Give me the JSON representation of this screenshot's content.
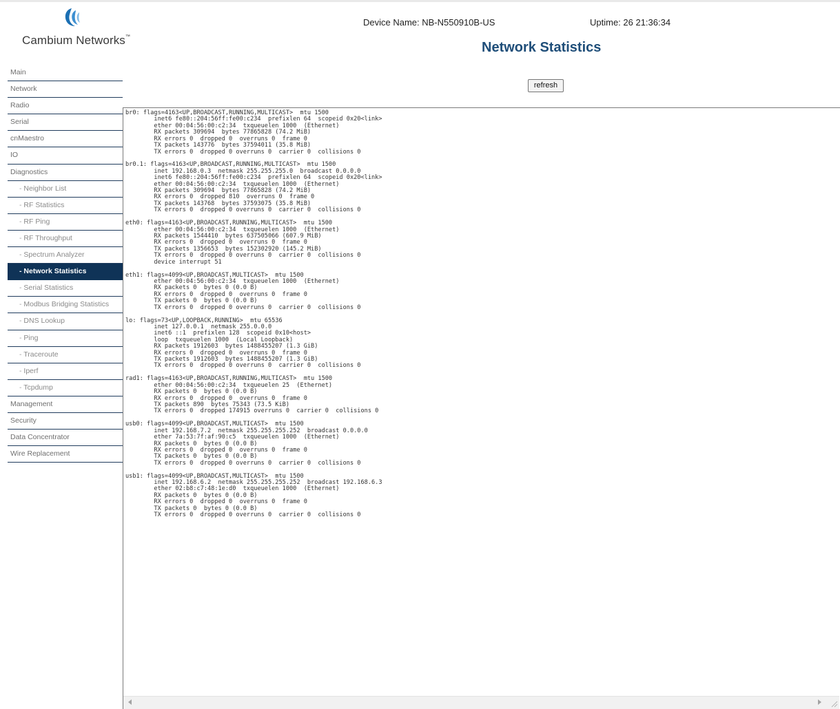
{
  "header": {
    "brand": "Cambium Networks",
    "trademark": "™",
    "device_name": "Device Name: NB-N550910B-US",
    "uptime": "Uptime: 26 21:36:34",
    "page_title": "Network Statistics"
  },
  "refresh_label": "refresh",
  "nav": {
    "items": [
      {
        "label": "Main",
        "sub": false,
        "active": false
      },
      {
        "label": "Network",
        "sub": false,
        "active": false
      },
      {
        "label": "Radio",
        "sub": false,
        "active": false
      },
      {
        "label": "Serial",
        "sub": false,
        "active": false
      },
      {
        "label": "cnMaestro",
        "sub": false,
        "active": false
      },
      {
        "label": "IO",
        "sub": false,
        "active": false
      },
      {
        "label": "Diagnostics",
        "sub": false,
        "active": false
      },
      {
        "label": "Neighbor List",
        "sub": true,
        "active": false
      },
      {
        "label": "RF Statistics",
        "sub": true,
        "active": false
      },
      {
        "label": "RF Ping",
        "sub": true,
        "active": false
      },
      {
        "label": "RF Throughput",
        "sub": true,
        "active": false
      },
      {
        "label": "Spectrum Analyzer",
        "sub": true,
        "active": false
      },
      {
        "label": "Network Statistics",
        "sub": true,
        "active": true
      },
      {
        "label": "Serial Statistics",
        "sub": true,
        "active": false
      },
      {
        "label": "Modbus Bridging Statistics",
        "sub": true,
        "active": false
      },
      {
        "label": "DNS Lookup",
        "sub": true,
        "active": false
      },
      {
        "label": "Ping",
        "sub": true,
        "active": false
      },
      {
        "label": "Traceroute",
        "sub": true,
        "active": false
      },
      {
        "label": "Iperf",
        "sub": true,
        "active": false
      },
      {
        "label": "Tcpdump",
        "sub": true,
        "active": false
      },
      {
        "label": "Management",
        "sub": false,
        "active": false
      },
      {
        "label": "Security",
        "sub": false,
        "active": false
      },
      {
        "label": "Data Concentrator",
        "sub": false,
        "active": false
      },
      {
        "label": "Wire Replacement",
        "sub": false,
        "active": false
      }
    ]
  },
  "stats_output": "br0: flags=4163<UP,BROADCAST,RUNNING,MULTICAST>  mtu 1500\n        inet6 fe80::204:56ff:fe00:c234  prefixlen 64  scopeid 0x20<link>\n        ether 00:04:56:00:c2:34  txqueuelen 1000  (Ethernet)\n        RX packets 309694  bytes 77865828 (74.2 MiB)\n        RX errors 0  dropped 0  overruns 0  frame 0\n        TX packets 143776  bytes 37594011 (35.8 MiB)\n        TX errors 0  dropped 0 overruns 0  carrier 0  collisions 0\n\nbr0.1: flags=4163<UP,BROADCAST,RUNNING,MULTICAST>  mtu 1500\n        inet 192.168.0.3  netmask 255.255.255.0  broadcast 0.0.0.0\n        inet6 fe80::204:56ff:fe00:c234  prefixlen 64  scopeid 0x20<link>\n        ether 00:04:56:00:c2:34  txqueuelen 1000  (Ethernet)\n        RX packets 309694  bytes 77865828 (74.2 MiB)\n        RX errors 0  dropped 810  overruns 0  frame 0\n        TX packets 143768  bytes 37593075 (35.8 MiB)\n        TX errors 0  dropped 0 overruns 0  carrier 0  collisions 0\n\neth0: flags=4163<UP,BROADCAST,RUNNING,MULTICAST>  mtu 1500\n        ether 00:04:56:00:c2:34  txqueuelen 1000  (Ethernet)\n        RX packets 1544410  bytes 637505066 (607.9 MiB)\n        RX errors 0  dropped 0  overruns 0  frame 0\n        TX packets 1356653  bytes 152302920 (145.2 MiB)\n        TX errors 0  dropped 0 overruns 0  carrier 0  collisions 0\n        device interrupt 51\n\neth1: flags=4099<UP,BROADCAST,MULTICAST>  mtu 1500\n        ether 00:04:56:00:c2:34  txqueuelen 1000  (Ethernet)\n        RX packets 0  bytes 0 (0.0 B)\n        RX errors 0  dropped 0  overruns 0  frame 0\n        TX packets 0  bytes 0 (0.0 B)\n        TX errors 0  dropped 0 overruns 0  carrier 0  collisions 0\n\nlo: flags=73<UP,LOOPBACK,RUNNING>  mtu 65536\n        inet 127.0.0.1  netmask 255.0.0.0\n        inet6 ::1  prefixlen 128  scopeid 0x10<host>\n        loop  txqueuelen 1000  (Local Loopback)\n        RX packets 1912603  bytes 1488455207 (1.3 GiB)\n        RX errors 0  dropped 0  overruns 0  frame 0\n        TX packets 1912603  bytes 1488455207 (1.3 GiB)\n        TX errors 0  dropped 0 overruns 0  carrier 0  collisions 0\n\nrad1: flags=4163<UP,BROADCAST,RUNNING,MULTICAST>  mtu 1500\n        ether 00:04:56:00:c2:34  txqueuelen 25  (Ethernet)\n        RX packets 0  bytes 0 (0.0 B)\n        RX errors 0  dropped 0  overruns 0  frame 0\n        TX packets 890  bytes 75343 (73.5 KiB)\n        TX errors 0  dropped 174915 overruns 0  carrier 0  collisions 0\n\nusb0: flags=4099<UP,BROADCAST,MULTICAST>  mtu 1500\n        inet 192.168.7.2  netmask 255.255.255.252  broadcast 0.0.0.0\n        ether 7a:53:7f:af:90:c5  txqueuelen 1000  (Ethernet)\n        RX packets 0  bytes 0 (0.0 B)\n        RX errors 0  dropped 0  overruns 0  frame 0\n        TX packets 0  bytes 0 (0.0 B)\n        TX errors 0  dropped 0 overruns 0  carrier 0  collisions 0\n\nusb1: flags=4099<UP,BROADCAST,MULTICAST>  mtu 1500\n        inet 192.168.6.2  netmask 255.255.255.252  broadcast 192.168.6.3\n        ether 02:b8:c7:48:1e:d0  txqueuelen 1000  (Ethernet)\n        RX packets 0  bytes 0 (0.0 B)\n        RX errors 0  dropped 0  overruns 0  frame 0\n        TX packets 0  bytes 0 (0.0 B)\n        TX errors 0  dropped 0 overruns 0  carrier 0  collisions 0",
  "icons": {
    "logo": "cambium-logo-icon",
    "scroll_left": "scroll-left-icon",
    "scroll_right": "scroll-right-icon",
    "resize": "resize-grip-icon"
  },
  "colors": {
    "brand_blue": "#1f4e79",
    "nav_active_bg": "#0f3357",
    "nav_divider": "#1f3b5c",
    "logo_blue": "#1b6fb3"
  }
}
